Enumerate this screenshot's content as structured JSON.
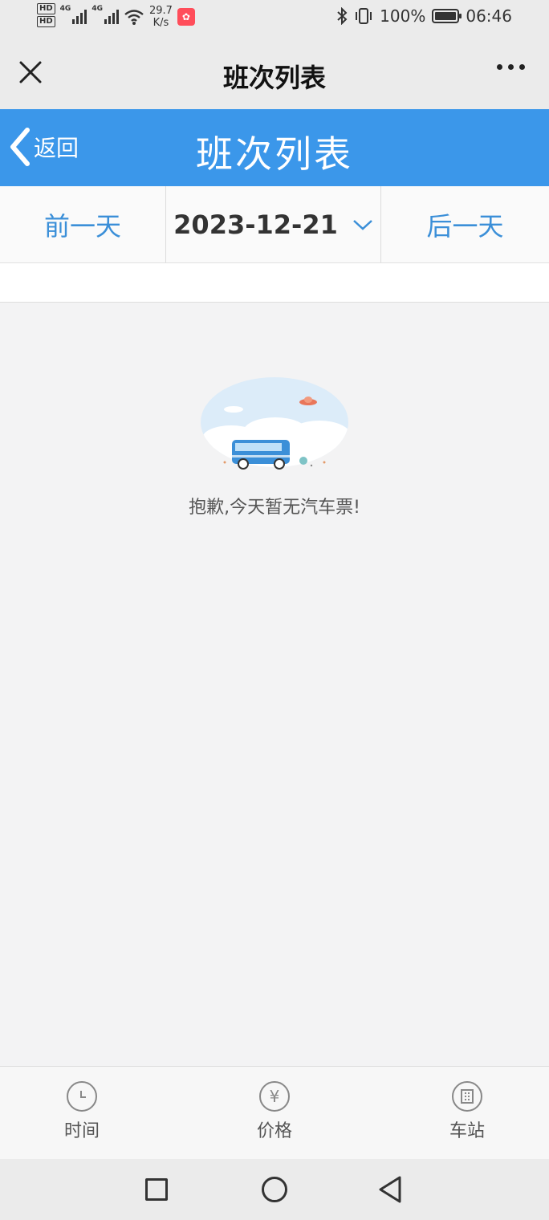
{
  "status_bar": {
    "hd1": "HD",
    "hd2": "HD",
    "net1": "4G",
    "net2": "4G",
    "speed_value": "29.7",
    "speed_unit": "K/s",
    "battery": "100%",
    "time": "06:46",
    "battery_level": 1.0
  },
  "titlebar": {
    "title": "班次列表"
  },
  "header": {
    "back_label": "返回",
    "title": "班次列表",
    "color": "#3b97ea"
  },
  "date_nav": {
    "prev_label": "前一天",
    "date": "2023-12-21",
    "next_label": "后一天",
    "accent": "#3b8fd8"
  },
  "empty_state": {
    "message": "抱歉,今天暂无汽车票!"
  },
  "tabs": [
    {
      "label": "时间",
      "icon": "clock-icon"
    },
    {
      "label": "价格",
      "icon": "yen-icon"
    },
    {
      "label": "车站",
      "icon": "building-icon"
    }
  ]
}
